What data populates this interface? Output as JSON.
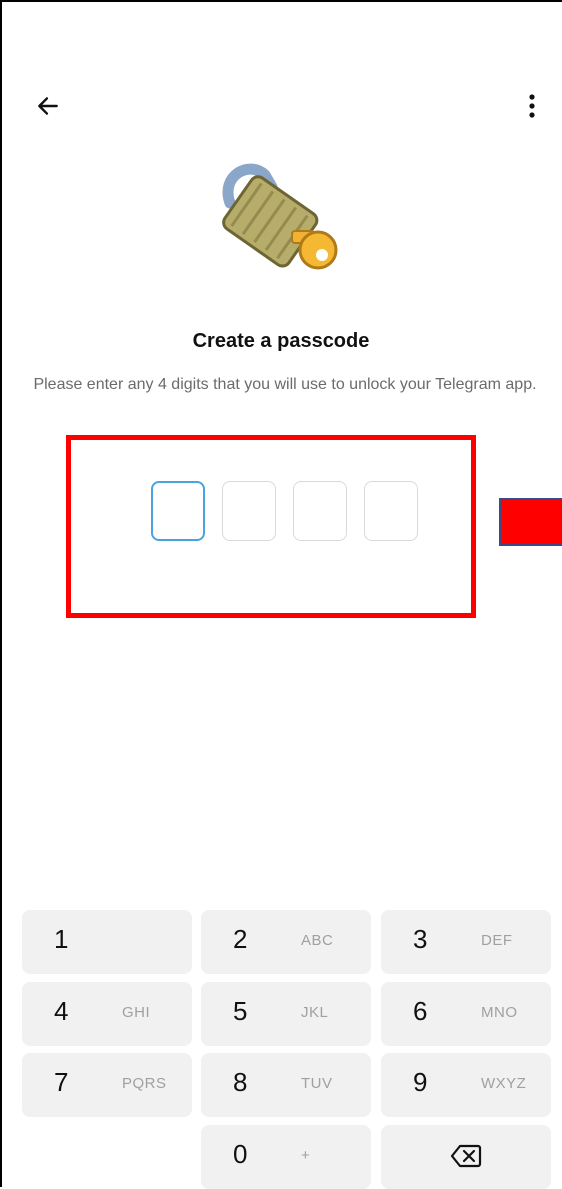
{
  "header": {
    "back_icon": "arrow-left-icon",
    "menu_icon": "more-vertical-icon"
  },
  "hero": {
    "icon": "lock-with-key-emoji"
  },
  "title": "Create a passcode",
  "subtitle": "Please enter any 4 digits that you will use to unlock your Telegram app.",
  "passcode": {
    "length": 4,
    "filled": 0
  },
  "keypad": {
    "keys": [
      {
        "digit": "1",
        "letters": ""
      },
      {
        "digit": "2",
        "letters": "ABC"
      },
      {
        "digit": "3",
        "letters": "DEF"
      },
      {
        "digit": "4",
        "letters": "GHI"
      },
      {
        "digit": "5",
        "letters": "JKL"
      },
      {
        "digit": "6",
        "letters": "MNO"
      },
      {
        "digit": "7",
        "letters": "PQRS"
      },
      {
        "digit": "8",
        "letters": "TUV"
      },
      {
        "digit": "9",
        "letters": "WXYZ"
      },
      {
        "digit": "0",
        "letters": "+"
      }
    ],
    "backspace_icon": "backspace-icon"
  },
  "colors": {
    "accent": "#4aa3df",
    "highlight": "#ff0000",
    "key_bg": "#f1f1f1"
  }
}
